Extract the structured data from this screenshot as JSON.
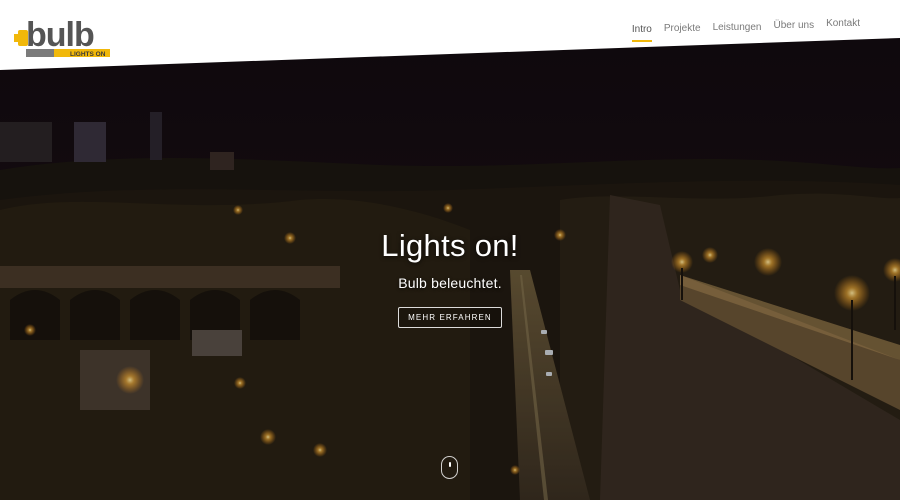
{
  "brand": {
    "logo_text": "bulb",
    "logo_tagline": "LIGHTS ON",
    "accent_color": "#f1b80a"
  },
  "nav": {
    "items": [
      {
        "label": "Intro",
        "active": true
      },
      {
        "label": "Projekte",
        "active": false
      },
      {
        "label": "Leistungen",
        "active": false
      },
      {
        "label": "Über uns",
        "active": false
      },
      {
        "label": "Kontakt",
        "active": false
      }
    ]
  },
  "hero": {
    "title": "Lights on!",
    "subtitle": "Bulb beleuchtet.",
    "cta_label": "MEHR ERFAHREN",
    "background_description_icon": "night-city-photo",
    "scroll_icon": "mouse-scroll-icon"
  }
}
